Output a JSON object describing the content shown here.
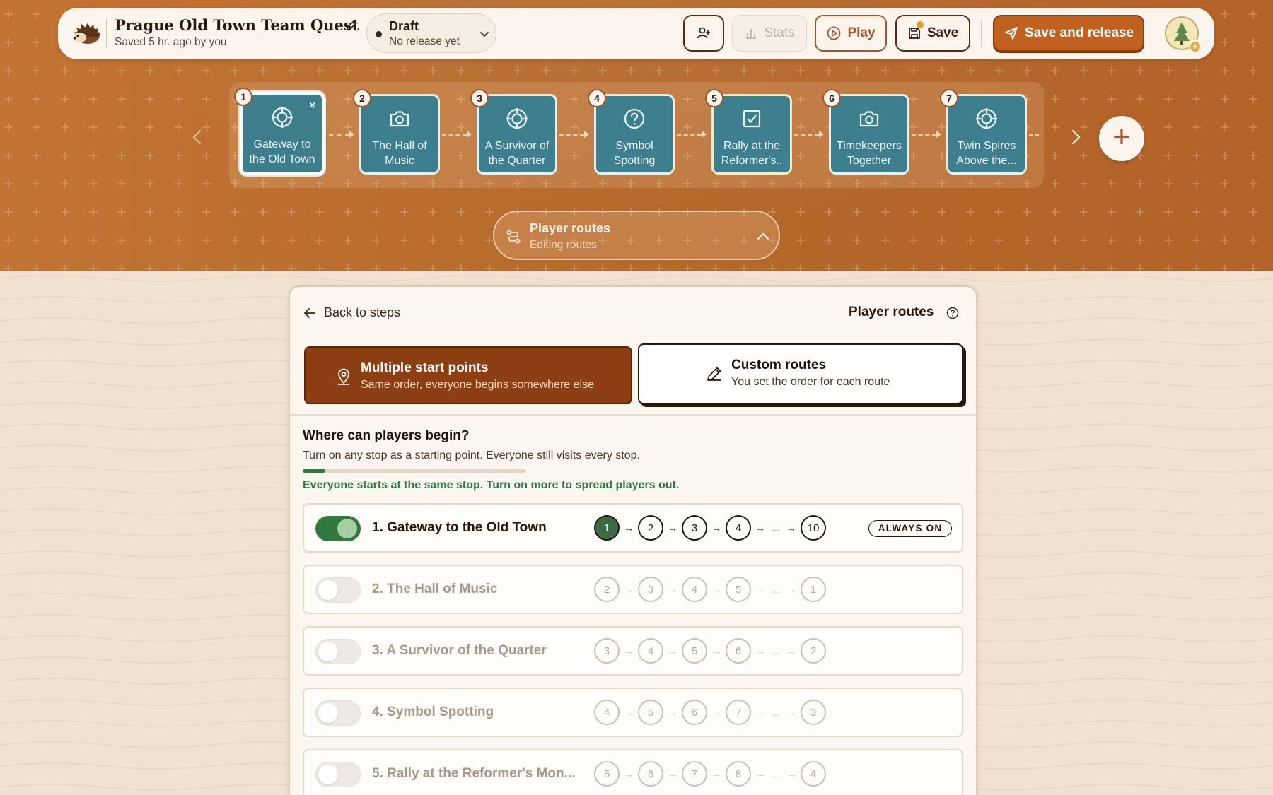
{
  "header": {
    "project_title": "Prague Old Town Team Quest",
    "saved_text": "Saved 5 hr. ago by you",
    "status": {
      "label": "Draft",
      "sub": "No release yet"
    },
    "buttons": {
      "stats": "Stats",
      "play": "Play",
      "save": "Save",
      "save_and_release": "Save and release"
    }
  },
  "steps": [
    {
      "num": "1",
      "label": "Gateway to the Old Town",
      "icon": "crosshair-icon",
      "active": true
    },
    {
      "num": "2",
      "label": "The Hall of Music",
      "icon": "camera-icon"
    },
    {
      "num": "3",
      "label": "A Survivor of the Quarter",
      "icon": "crosshair-icon"
    },
    {
      "num": "4",
      "label": "Symbol Spotting",
      "icon": "question-icon"
    },
    {
      "num": "5",
      "label": "Rally at the Reformer's..",
      "icon": "checkbox-icon"
    },
    {
      "num": "6",
      "label": "Timekeepers Together",
      "icon": "camera-icon"
    },
    {
      "num": "7",
      "label": "Twin Spires Above the...",
      "icon": "crosshair-icon"
    }
  ],
  "routes_pill": {
    "title": "Player routes",
    "sub": "Editing routes"
  },
  "panel": {
    "back_label": "Back to steps",
    "title": "Player routes",
    "options": {
      "multi": {
        "title": "Multiple start points",
        "sub": "Same order, everyone begins somewhere else"
      },
      "custom": {
        "title": "Custom routes",
        "sub": "You set the order for each route"
      }
    },
    "question": "Where can players begin?",
    "question_sub": "Turn on any stop as a starting point. Everyone still visits every stop.",
    "progress": 0.1,
    "hint": "Everyone starts at the same stop. Turn on more to spread players out.",
    "always_on": "ALWAYS ON",
    "ellipsis": "...",
    "routes": [
      {
        "label": "1. Gateway to the Old Town",
        "on": true,
        "seq": [
          "1",
          "2",
          "3",
          "4",
          "10"
        ]
      },
      {
        "label": "2. The Hall of Music",
        "on": false,
        "seq": [
          "2",
          "3",
          "4",
          "5",
          "1"
        ]
      },
      {
        "label": "3. A Survivor of the Quarter",
        "on": false,
        "seq": [
          "3",
          "4",
          "5",
          "6",
          "2"
        ]
      },
      {
        "label": "4. Symbol Spotting",
        "on": false,
        "seq": [
          "4",
          "5",
          "6",
          "7",
          "3"
        ]
      },
      {
        "label": "5. Rally at the Reformer's Mon...",
        "on": false,
        "seq": [
          "5",
          "6",
          "7",
          "8",
          "4"
        ]
      }
    ]
  },
  "colors": {
    "band": "#b86a2c",
    "accent": "#c0611f",
    "step_teal": "#3e7f8f",
    "toggle_on": "#2f7a3c"
  }
}
